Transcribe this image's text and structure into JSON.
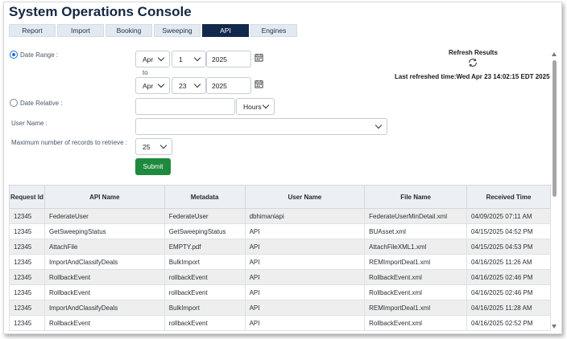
{
  "app": {
    "title": "System Operations Console"
  },
  "tabs": [
    {
      "label": "Report",
      "active": false
    },
    {
      "label": "Import",
      "active": false
    },
    {
      "label": "Booking",
      "active": false
    },
    {
      "label": "Sweeping",
      "active": false
    },
    {
      "label": "API",
      "active": true
    },
    {
      "label": "Engines",
      "active": false
    }
  ],
  "filters": {
    "date_range_label": "Date Range :",
    "date_range_selected": true,
    "from": {
      "month": "Apr",
      "day": "1",
      "year": "2025"
    },
    "to_label": "to",
    "to": {
      "month": "Apr",
      "day": "23",
      "year": "2025"
    },
    "date_relative_label": "Date Relative :",
    "relative_value": "",
    "relative_unit": "Hours",
    "user_name_label": "User Name :",
    "user_name_value": "",
    "max_records_label": "Maximum number of records to retrieve :",
    "max_records_value": "25",
    "submit_label": "Submit"
  },
  "refresh": {
    "label": "Refresh Results",
    "last_refreshed": "Last refreshed time:Wed Apr 23 14:02:15 EDT 2025"
  },
  "table": {
    "headers": [
      "Request Id",
      "API Name",
      "Metadata",
      "User Name",
      "File Name",
      "Received Time"
    ],
    "rows": [
      [
        "12345",
        "FederateUser",
        "FederateUser",
        "dbhimaniapi",
        "FederateUserMinDetail.xml",
        "04/09/2025 07:11 AM"
      ],
      [
        "12345",
        "GetSweepingStatus",
        "GetSweepingStatus",
        "API",
        "BUAsset.xml",
        "04/15/2025 04:52 PM"
      ],
      [
        "12345",
        "AttachFile",
        "EMPTY.pdf",
        "API",
        "AttachFileXML1.xml",
        "04/15/2025 04:53 PM"
      ],
      [
        "12345",
        "ImportAndClassifyDeals",
        "BulkImport",
        "API",
        "REMImportDeal1.xml",
        "04/16/2025 11:26 AM"
      ],
      [
        "12345",
        "RollbackEvent",
        "rollbackEvent",
        "API",
        "RollbackEvent.xml",
        "04/16/2025 02:46 PM"
      ],
      [
        "12345",
        "RollbackEvent",
        "rollbackEvent",
        "API",
        "RollbackEvent.xml",
        "04/16/2025 02:46 PM"
      ],
      [
        "12345",
        "ImportAndClassifyDeals",
        "BulkImport",
        "API",
        "REMImportDeal1.xml",
        "04/16/2025 11:28 AM"
      ],
      [
        "12345",
        "RollbackEvent",
        "rollbackEvent",
        "API",
        "RollbackEvent.xml",
        "04/16/2025 02:52 PM"
      ]
    ]
  },
  "colors": {
    "brand": "#13294b",
    "submit": "#1e8a3d",
    "accent": "#1f6fd1"
  },
  "icons": [
    "calendar-icon",
    "refresh-icon",
    "chevron-down-icon"
  ]
}
